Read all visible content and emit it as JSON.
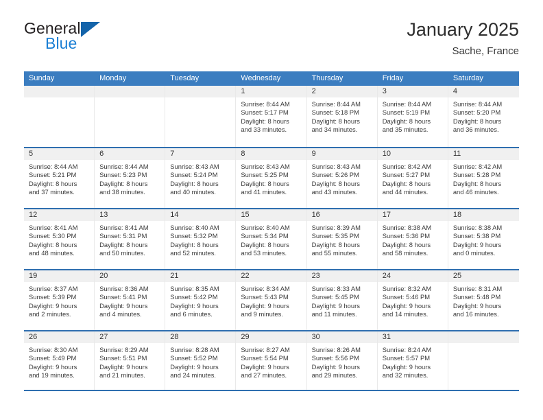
{
  "brand": {
    "name_part1": "General",
    "name_part2": "Blue",
    "logo_icon": "triangle-logo-icon"
  },
  "header": {
    "title": "January 2025",
    "location": "Sache, France"
  },
  "calendar": {
    "day_names": [
      "Sunday",
      "Monday",
      "Tuesday",
      "Wednesday",
      "Thursday",
      "Friday",
      "Saturday"
    ],
    "colors": {
      "header_blue": "#3b7dc0",
      "row_divider_blue": "#2f6fb0",
      "daynum_band": "#f0f0f0",
      "brand_blue": "#1b7fd4",
      "logo_blue": "#1464aa"
    },
    "weeks": [
      [
        {
          "day": "",
          "empty": true
        },
        {
          "day": "",
          "empty": true
        },
        {
          "day": "",
          "empty": true
        },
        {
          "day": "1",
          "sunrise": "Sunrise: 8:44 AM",
          "sunset": "Sunset: 5:17 PM",
          "daylight1": "Daylight: 8 hours",
          "daylight2": "and 33 minutes."
        },
        {
          "day": "2",
          "sunrise": "Sunrise: 8:44 AM",
          "sunset": "Sunset: 5:18 PM",
          "daylight1": "Daylight: 8 hours",
          "daylight2": "and 34 minutes."
        },
        {
          "day": "3",
          "sunrise": "Sunrise: 8:44 AM",
          "sunset": "Sunset: 5:19 PM",
          "daylight1": "Daylight: 8 hours",
          "daylight2": "and 35 minutes."
        },
        {
          "day": "4",
          "sunrise": "Sunrise: 8:44 AM",
          "sunset": "Sunset: 5:20 PM",
          "daylight1": "Daylight: 8 hours",
          "daylight2": "and 36 minutes."
        }
      ],
      [
        {
          "day": "5",
          "sunrise": "Sunrise: 8:44 AM",
          "sunset": "Sunset: 5:21 PM",
          "daylight1": "Daylight: 8 hours",
          "daylight2": "and 37 minutes."
        },
        {
          "day": "6",
          "sunrise": "Sunrise: 8:44 AM",
          "sunset": "Sunset: 5:23 PM",
          "daylight1": "Daylight: 8 hours",
          "daylight2": "and 38 minutes."
        },
        {
          "day": "7",
          "sunrise": "Sunrise: 8:43 AM",
          "sunset": "Sunset: 5:24 PM",
          "daylight1": "Daylight: 8 hours",
          "daylight2": "and 40 minutes."
        },
        {
          "day": "8",
          "sunrise": "Sunrise: 8:43 AM",
          "sunset": "Sunset: 5:25 PM",
          "daylight1": "Daylight: 8 hours",
          "daylight2": "and 41 minutes."
        },
        {
          "day": "9",
          "sunrise": "Sunrise: 8:43 AM",
          "sunset": "Sunset: 5:26 PM",
          "daylight1": "Daylight: 8 hours",
          "daylight2": "and 43 minutes."
        },
        {
          "day": "10",
          "sunrise": "Sunrise: 8:42 AM",
          "sunset": "Sunset: 5:27 PM",
          "daylight1": "Daylight: 8 hours",
          "daylight2": "and 44 minutes."
        },
        {
          "day": "11",
          "sunrise": "Sunrise: 8:42 AM",
          "sunset": "Sunset: 5:28 PM",
          "daylight1": "Daylight: 8 hours",
          "daylight2": "and 46 minutes."
        }
      ],
      [
        {
          "day": "12",
          "sunrise": "Sunrise: 8:41 AM",
          "sunset": "Sunset: 5:30 PM",
          "daylight1": "Daylight: 8 hours",
          "daylight2": "and 48 minutes."
        },
        {
          "day": "13",
          "sunrise": "Sunrise: 8:41 AM",
          "sunset": "Sunset: 5:31 PM",
          "daylight1": "Daylight: 8 hours",
          "daylight2": "and 50 minutes."
        },
        {
          "day": "14",
          "sunrise": "Sunrise: 8:40 AM",
          "sunset": "Sunset: 5:32 PM",
          "daylight1": "Daylight: 8 hours",
          "daylight2": "and 52 minutes."
        },
        {
          "day": "15",
          "sunrise": "Sunrise: 8:40 AM",
          "sunset": "Sunset: 5:34 PM",
          "daylight1": "Daylight: 8 hours",
          "daylight2": "and 53 minutes."
        },
        {
          "day": "16",
          "sunrise": "Sunrise: 8:39 AM",
          "sunset": "Sunset: 5:35 PM",
          "daylight1": "Daylight: 8 hours",
          "daylight2": "and 55 minutes."
        },
        {
          "day": "17",
          "sunrise": "Sunrise: 8:38 AM",
          "sunset": "Sunset: 5:36 PM",
          "daylight1": "Daylight: 8 hours",
          "daylight2": "and 58 minutes."
        },
        {
          "day": "18",
          "sunrise": "Sunrise: 8:38 AM",
          "sunset": "Sunset: 5:38 PM",
          "daylight1": "Daylight: 9 hours",
          "daylight2": "and 0 minutes."
        }
      ],
      [
        {
          "day": "19",
          "sunrise": "Sunrise: 8:37 AM",
          "sunset": "Sunset: 5:39 PM",
          "daylight1": "Daylight: 9 hours",
          "daylight2": "and 2 minutes."
        },
        {
          "day": "20",
          "sunrise": "Sunrise: 8:36 AM",
          "sunset": "Sunset: 5:41 PM",
          "daylight1": "Daylight: 9 hours",
          "daylight2": "and 4 minutes."
        },
        {
          "day": "21",
          "sunrise": "Sunrise: 8:35 AM",
          "sunset": "Sunset: 5:42 PM",
          "daylight1": "Daylight: 9 hours",
          "daylight2": "and 6 minutes."
        },
        {
          "day": "22",
          "sunrise": "Sunrise: 8:34 AM",
          "sunset": "Sunset: 5:43 PM",
          "daylight1": "Daylight: 9 hours",
          "daylight2": "and 9 minutes."
        },
        {
          "day": "23",
          "sunrise": "Sunrise: 8:33 AM",
          "sunset": "Sunset: 5:45 PM",
          "daylight1": "Daylight: 9 hours",
          "daylight2": "and 11 minutes."
        },
        {
          "day": "24",
          "sunrise": "Sunrise: 8:32 AM",
          "sunset": "Sunset: 5:46 PM",
          "daylight1": "Daylight: 9 hours",
          "daylight2": "and 14 minutes."
        },
        {
          "day": "25",
          "sunrise": "Sunrise: 8:31 AM",
          "sunset": "Sunset: 5:48 PM",
          "daylight1": "Daylight: 9 hours",
          "daylight2": "and 16 minutes."
        }
      ],
      [
        {
          "day": "26",
          "sunrise": "Sunrise: 8:30 AM",
          "sunset": "Sunset: 5:49 PM",
          "daylight1": "Daylight: 9 hours",
          "daylight2": "and 19 minutes."
        },
        {
          "day": "27",
          "sunrise": "Sunrise: 8:29 AM",
          "sunset": "Sunset: 5:51 PM",
          "daylight1": "Daylight: 9 hours",
          "daylight2": "and 21 minutes."
        },
        {
          "day": "28",
          "sunrise": "Sunrise: 8:28 AM",
          "sunset": "Sunset: 5:52 PM",
          "daylight1": "Daylight: 9 hours",
          "daylight2": "and 24 minutes."
        },
        {
          "day": "29",
          "sunrise": "Sunrise: 8:27 AM",
          "sunset": "Sunset: 5:54 PM",
          "daylight1": "Daylight: 9 hours",
          "daylight2": "and 27 minutes."
        },
        {
          "day": "30",
          "sunrise": "Sunrise: 8:26 AM",
          "sunset": "Sunset: 5:56 PM",
          "daylight1": "Daylight: 9 hours",
          "daylight2": "and 29 minutes."
        },
        {
          "day": "31",
          "sunrise": "Sunrise: 8:24 AM",
          "sunset": "Sunset: 5:57 PM",
          "daylight1": "Daylight: 9 hours",
          "daylight2": "and 32 minutes."
        },
        {
          "day": "",
          "empty": true
        }
      ]
    ]
  }
}
